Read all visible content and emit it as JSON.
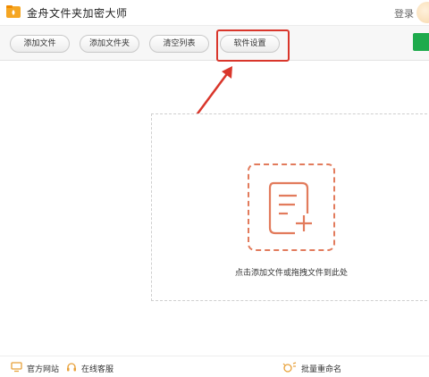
{
  "app": {
    "title": "金舟文件夹加密大师",
    "login_label": "登录"
  },
  "toolbar": {
    "buttons": [
      {
        "label": "添加文件"
      },
      {
        "label": "添加文件夹"
      },
      {
        "label": "清空列表"
      },
      {
        "label": "软件设置"
      }
    ]
  },
  "dropzone": {
    "hint": "点击添加文件或拖拽文件到此处"
  },
  "statusbar": {
    "website_label": "官方网站",
    "support_label": "在线客服",
    "rename_label": "批量重命名"
  },
  "colors": {
    "accent": "#e27b5c",
    "annotation": "#d9362b",
    "green": "#1eaa4c",
    "logo": "#f5a623"
  },
  "icons": {
    "logo": "folder-lock-icon",
    "drop": "add-document-icon",
    "website": "monitor-icon",
    "support": "headset-icon",
    "rename": "batch-rename-icon"
  }
}
